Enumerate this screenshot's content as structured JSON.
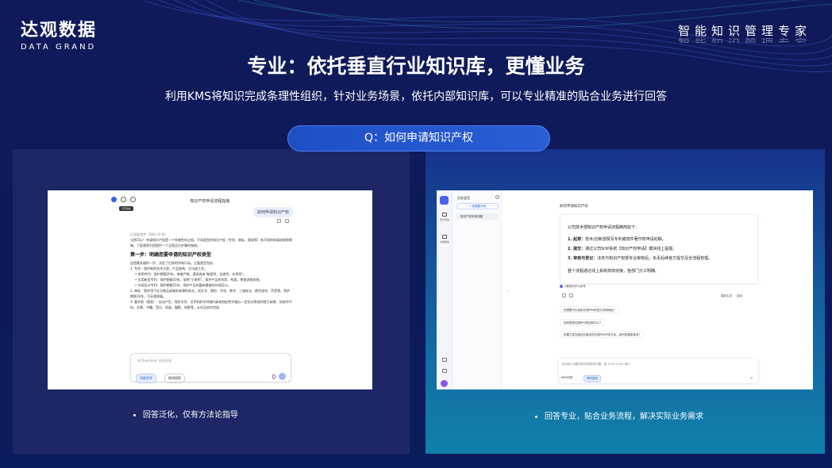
{
  "brand": {
    "logo_cn": "达观数据",
    "logo_en": "DATA GRAND",
    "slogan": "智能知识管理专家"
  },
  "slide": {
    "title": "专业：依托垂直行业知识库，更懂业务",
    "subtitle": "利用KMS将知识完成条理性组织，针对业务场景，依托内部知识库，可以专业精准的贴合业务进行回答",
    "question": "Q：如何申请知识产权",
    "caption_left": "回答泛化，仅有方法论指导",
    "caption_right": "回答专业，贴合业务流程，解决实际业务需求"
  },
  "left_app": {
    "header": "知识产权申请流程指南",
    "tooltip": "打开边栏",
    "user_bubble": "如何申请知识产权",
    "thinking": "已深度思考（用时 10 秒）",
    "intro": "当然可以！申请知识产权是一个系统性的过程。不同类型的知识产权（专利、商标、版权等）有不同的申请流程和策略。下面我将为您提供一个全面且分步骤的指南。",
    "step_title": "第一步：明确您要申请的知识产权类型",
    "step_desc": "这是最关键的一步，决定了后续的所有行动。主要类型包括：",
    "items": [
      "1. 专利 - 保护新的技术方案、产品结构、方法或工艺。",
      "• 发明专利：保护期限20年，审查严格，要求具有\"新颖性、创造性、实用性\"。",
      "• 实用新型专利：保护期限10年，俗称\"小发明\"，保护产品的形状、构造。审查流程较快。",
      "• 外观设计专利：保护期限15年，保护产品的富有美感的外观设计。",
      "2. 商标 - 保护用于区分商品或服务来源的标志，如文字、图形、字母、数字、三维标志、颜色组合、声音等。保护期限10年，可无限续展。",
      "3. 著作权（版权）- 自动产生，保护文学、艺术和科学领域内具有独创性并能以一定形式表现的智力成果，如软件代码、文章、书籍、音乐、绘画、摄影、电影等。从作品创作完成"
    ],
    "input_placeholder": "给 DeepSeek 发送消息",
    "chip_deep": "深度思考",
    "chip_search": "联网搜索"
  },
  "right_app": {
    "history_title": "历史会话",
    "new_chat": "+ 新建聊天吧",
    "history_item": "知识产权申请流程",
    "nav_kb": "知识问答",
    "nav_doc": "文档阅读",
    "question_header": "如何申请知识产权",
    "answer_intro": "公司技术部知识产权申请流程精简如下：",
    "answer_steps": [
      {
        "label": "1. 起草：",
        "text": "技术/创新部撰写专利或软件著作权申请初稿。"
      },
      {
        "label": "2. 提交：",
        "text": "通过公司SOP系统【知识产权申请】模块线上提报。"
      },
      {
        "label": "3. 审核与登记：",
        "text": "法务与知识产权部专业审核后，负责后续官方提交及全流程管理。"
      }
    ],
    "answer_outro": "整个流程通过线上系统高效衔接，各部门分工明确。",
    "ref_label": "2篇资料作为参考",
    "regenerate": "重新生成",
    "copy": "复制",
    "suggestions": [
      "在哪里可以找到达观RPA的官方试用地址?",
      "如何登录达观RPA的控制中心?",
      "如果之前安装过旧版本的达观RPA开发平台，如何安装新版本?"
    ],
    "input_placeholder": "在此输入问题或按/获取推荐问题，按 Shift+Enter 换行",
    "model_label": "KMS问答",
    "mode_label": "联网搜索"
  }
}
